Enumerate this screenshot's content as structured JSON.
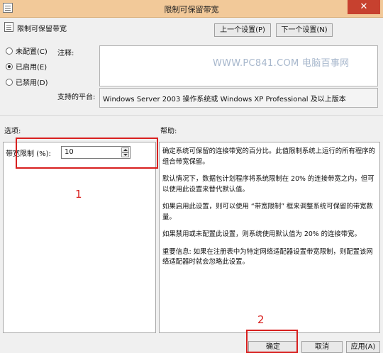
{
  "window": {
    "title": "限制可保留带宽",
    "close_glyph": "✕"
  },
  "setting_name": "限制可保留带宽",
  "nav": {
    "prev": "上一个设置(P)",
    "next": "下一个设置(N)"
  },
  "state": {
    "options": [
      {
        "label": "未配置(C)",
        "selected": false
      },
      {
        "label": "已启用(E)",
        "selected": true
      },
      {
        "label": "已禁用(D)",
        "selected": false
      }
    ]
  },
  "comment_label": "注释:",
  "watermark": "WWW.PC841.COM 电脑百事网",
  "platform": {
    "label": "支持的平台:",
    "value": "Windows Server 2003 操作系统或 Windows XP Professional 及以上版本"
  },
  "options_header": "选项:",
  "help_header": "帮助:",
  "bandwidth": {
    "label": "带宽限制 (%):",
    "value": "10"
  },
  "help_paragraphs": [
    "确定系统可保留的连接带宽的百分比。此值限制系统上运行的所有程序的组合带宽保留。",
    "默认情况下，数据包计划程序将系统限制在 20% 的连接带宽之内，但可以使用此设置来替代默认值。",
    "如果启用此设置，则可以使用 “带宽限制” 框来调整系统可保留的带宽数量。",
    "如果禁用或未配置此设置，则系统使用默认值为 20% 的连接带宽。",
    "重要信息: 如果在注册表中为特定网络适配器设置带宽限制，则配置该网络适配器时就会忽略此设置。"
  ],
  "buttons": {
    "ok": "确定",
    "cancel": "取消",
    "apply": "应用(A)"
  },
  "annotations": {
    "marker_1": "1",
    "marker_2": "2",
    "highlight_color": "#d8201f"
  }
}
